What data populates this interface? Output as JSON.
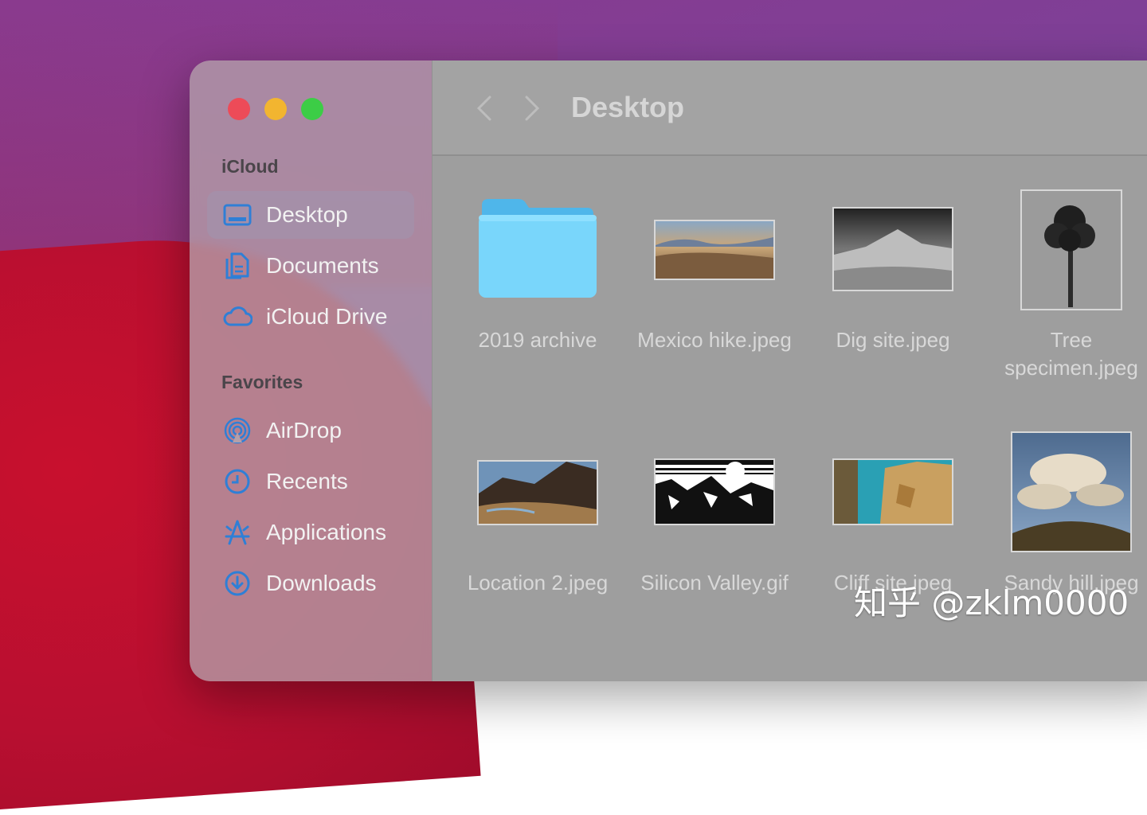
{
  "window": {
    "title": "Desktop"
  },
  "sidebar": {
    "sections": [
      {
        "title": "iCloud",
        "items": [
          {
            "label": "Desktop",
            "icon": "desktop-icon",
            "selected": true
          },
          {
            "label": "Documents",
            "icon": "documents-icon"
          },
          {
            "label": "iCloud Drive",
            "icon": "icloud-icon"
          }
        ]
      },
      {
        "title": "Favorites",
        "items": [
          {
            "label": "AirDrop",
            "icon": "airdrop-icon"
          },
          {
            "label": "Recents",
            "icon": "clock-icon"
          },
          {
            "label": "Applications",
            "icon": "applications-icon"
          },
          {
            "label": "Downloads",
            "icon": "downloads-icon"
          }
        ]
      }
    ]
  },
  "files": [
    {
      "name": "2019 archive",
      "kind": "folder"
    },
    {
      "name": "Mexico hike.jpeg",
      "kind": "image"
    },
    {
      "name": "Dig site.jpeg",
      "kind": "image"
    },
    {
      "name": "Tree specimen.jpeg",
      "kind": "image"
    },
    {
      "name": "Location 2.jpeg",
      "kind": "image"
    },
    {
      "name": "Silicon Valley.gif",
      "kind": "image"
    },
    {
      "name": "Cliff site.jpeg",
      "kind": "image"
    },
    {
      "name": "Sandy hill.jpeg",
      "kind": "image"
    }
  ],
  "colors": {
    "accent": "#2f7fd6",
    "folder": "#6ed0f8",
    "close": "#ed4b58",
    "minimize": "#f2b530",
    "maximize": "#3ccd46"
  },
  "watermark": "知乎 @zklm0000"
}
